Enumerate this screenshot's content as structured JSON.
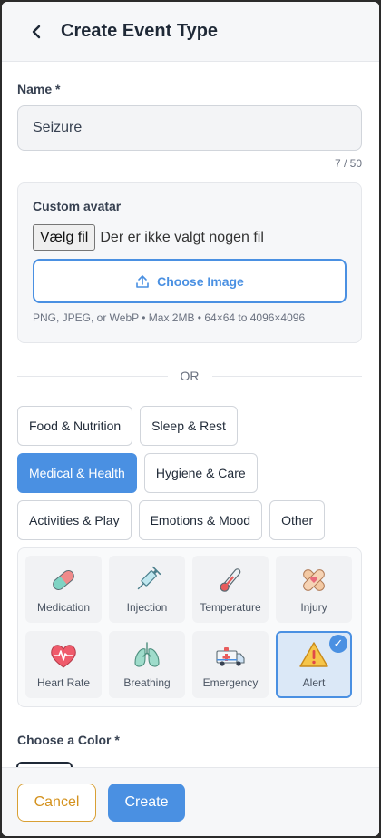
{
  "header": {
    "title": "Create Event Type",
    "back_icon": "chevron-left-icon"
  },
  "name_field": {
    "label": "Name *",
    "value": "Seizure",
    "char_count": "7 / 50"
  },
  "avatar": {
    "title": "Custom avatar",
    "file_button": "Vælg fil",
    "file_status": "Der er ikke valgt nogen fil",
    "choose_button": "Choose Image",
    "choose_icon": "upload-icon",
    "hint": "PNG, JPEG, or WebP • Max 2MB • 64×64 to 4096×4096"
  },
  "divider": {
    "text": "OR"
  },
  "categories": [
    {
      "label": "Food & Nutrition",
      "active": false
    },
    {
      "label": "Sleep & Rest",
      "active": false
    },
    {
      "label": "Medical & Health",
      "active": true
    },
    {
      "label": "Hygiene & Care",
      "active": false
    },
    {
      "label": "Activities & Play",
      "active": false
    },
    {
      "label": "Emotions & Mood",
      "active": false
    },
    {
      "label": "Other",
      "active": false
    }
  ],
  "icons": [
    {
      "label": "Medication",
      "icon": "pill-icon",
      "selected": false
    },
    {
      "label": "Injection",
      "icon": "syringe-icon",
      "selected": false
    },
    {
      "label": "Temperature",
      "icon": "thermometer-icon",
      "selected": false
    },
    {
      "label": "Injury",
      "icon": "bandage-icon",
      "selected": false
    },
    {
      "label": "Heart Rate",
      "icon": "heart-pulse-icon",
      "selected": false
    },
    {
      "label": "Breathing",
      "icon": "lungs-icon",
      "selected": false
    },
    {
      "label": "Emergency",
      "icon": "ambulance-icon",
      "selected": false
    },
    {
      "label": "Alert",
      "icon": "warning-icon",
      "selected": true,
      "check": "✓"
    }
  ],
  "color_section": {
    "label": "Choose a Color *"
  },
  "footer": {
    "cancel": "Cancel",
    "create": "Create"
  },
  "colors": {
    "accent": "#4a90e2",
    "cancel": "#d4921e",
    "surface": "#f6f7f9"
  }
}
